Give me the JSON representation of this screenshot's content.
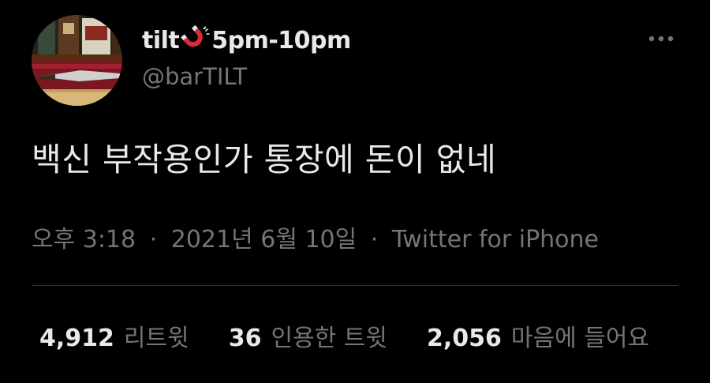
{
  "author": {
    "name": "tilt",
    "name_suffix": "5pm-10pm",
    "name_emoji": "magnet-icon",
    "handle": "@barTILT"
  },
  "tweet": {
    "text": "백신 부작용인가 통장에 돈이 없네"
  },
  "meta": {
    "time": "오후 3:18",
    "date": "2021년 6월 10일",
    "separator": "·",
    "source": "Twitter for iPhone"
  },
  "stats": [
    {
      "count": "4,912",
      "label": "리트윗"
    },
    {
      "count": "36",
      "label": "인용한 트윗"
    },
    {
      "count": "2,056",
      "label": "마음에 들어요"
    }
  ],
  "colors": {
    "background": "#000000",
    "primary_text": "#e7e9ea",
    "secondary_text": "#71767b",
    "divider": "#2f3336",
    "magnet_red": "#d62d38"
  },
  "icons": {
    "more": "more-horizontal-icon",
    "avatar": "profile-photo"
  }
}
